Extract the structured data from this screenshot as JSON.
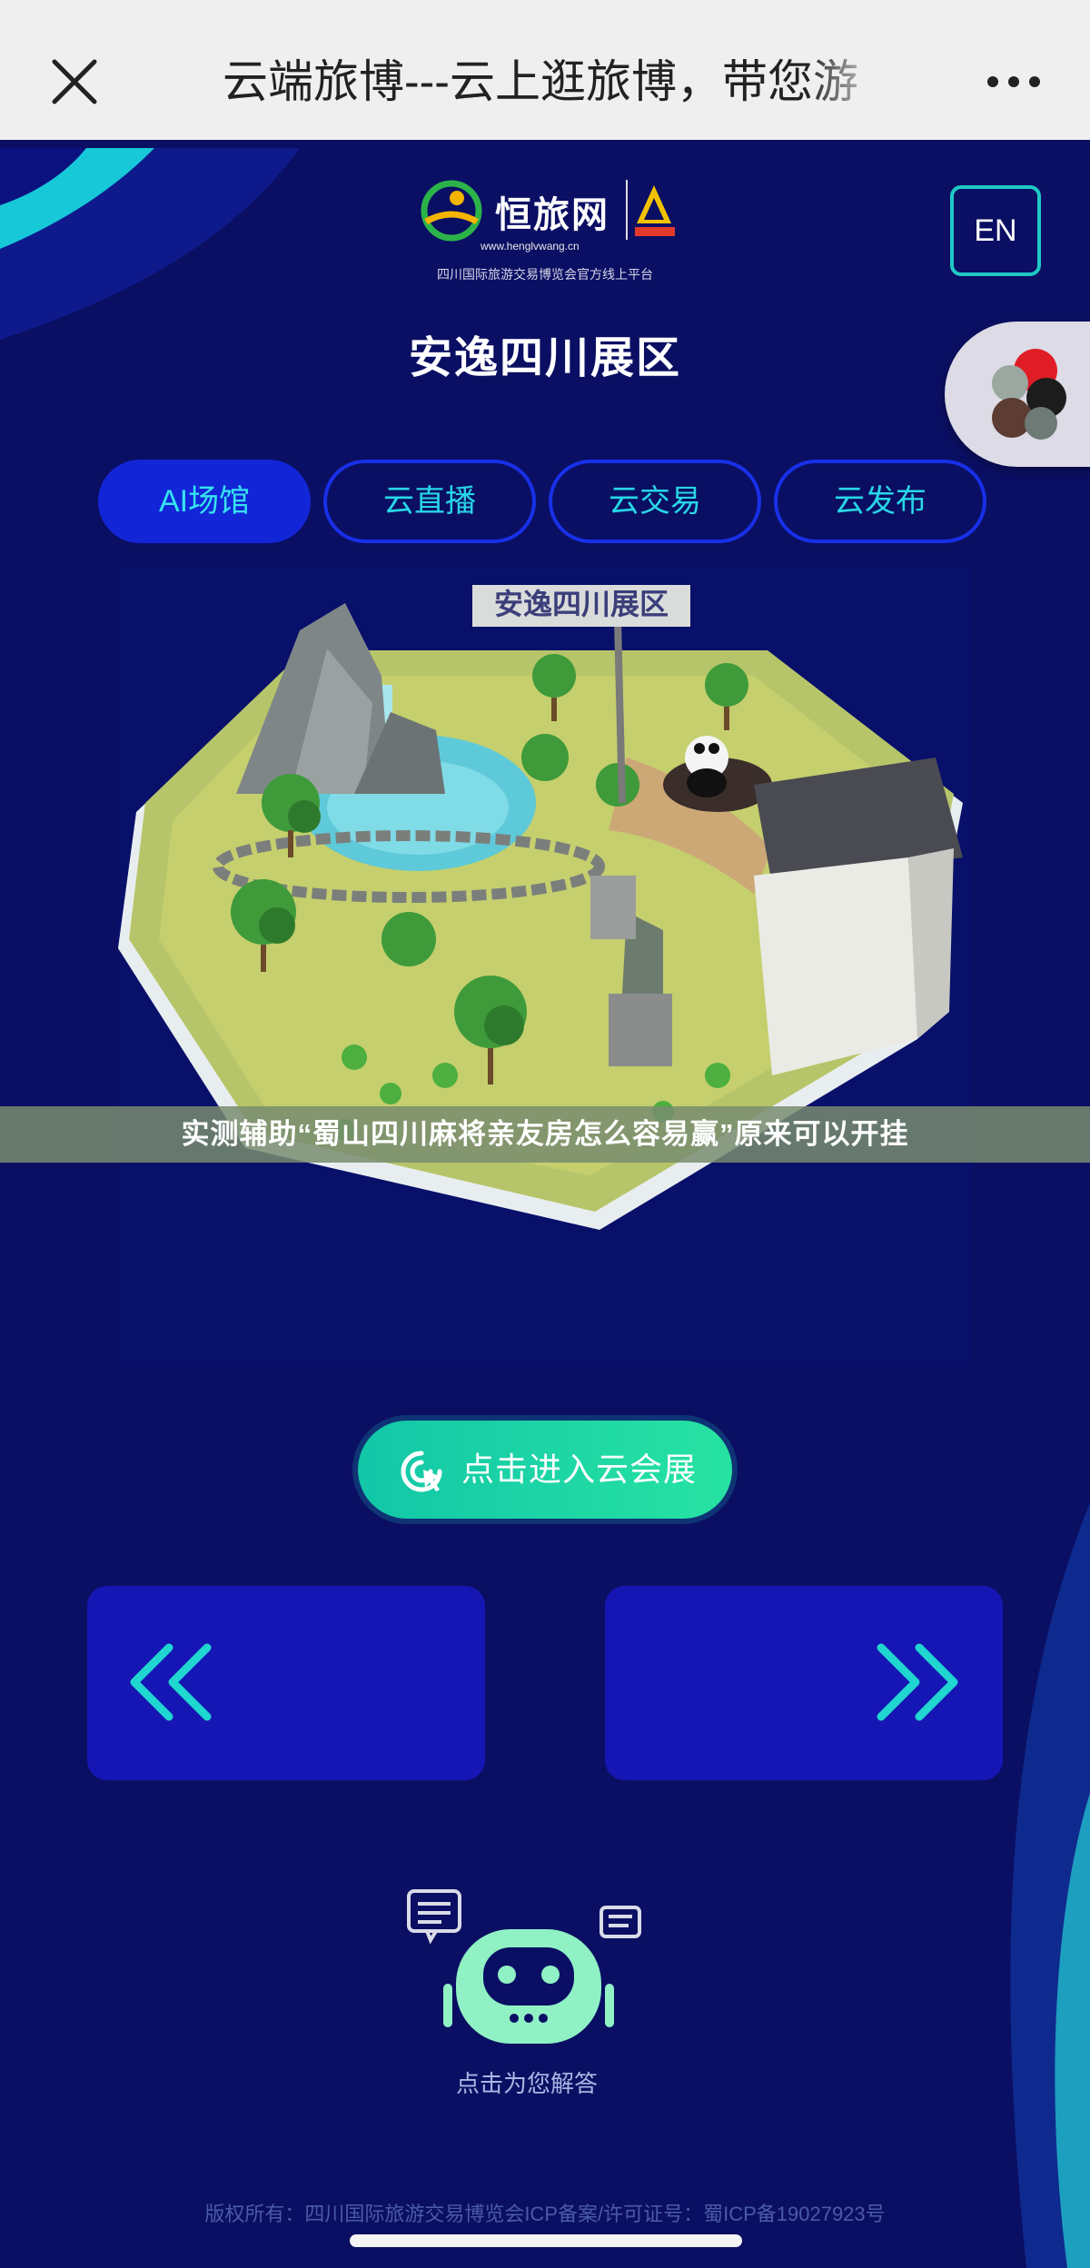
{
  "browser": {
    "title": "云端旅博---云上逛旅博，带您游"
  },
  "header": {
    "logo_name": "恒旅网",
    "logo_url": "www.henglvwang.cn",
    "logo_caption": "四川国际旅游交易博览会官方线上平台",
    "lang_label": "EN",
    "page_title": "安逸四川展区"
  },
  "tabs": [
    {
      "label": "AI场馆",
      "active": true
    },
    {
      "label": "云直播",
      "active": false
    },
    {
      "label": "云交易",
      "active": false
    },
    {
      "label": "云发布",
      "active": false
    }
  ],
  "scene": {
    "sign_text": "安逸四川展区"
  },
  "banner": {
    "text": "实测辅助“蜀山四川麻将亲友房怎么容易赢”原来可以开挂"
  },
  "enter_button": {
    "label": "点击进入云会展"
  },
  "assistant": {
    "label": "点击为您解答"
  },
  "footer": {
    "text": "版权所有：四川国际旅游交易博览会ICP备案/许可证号：蜀ICP备19027923号"
  },
  "colors": {
    "background": "#0a0f63",
    "tab_border": "#1830e8",
    "accent_teal": "#20c8c4",
    "button_green": "#1dd0a4",
    "progress_green": "#1dbf3a"
  },
  "icons": {
    "close": "close-icon",
    "more": "more-icon",
    "enter": "cursor-click-icon",
    "prev": "double-chevron-left-icon",
    "next": "double-chevron-right-icon",
    "assistant": "robot-icon"
  }
}
